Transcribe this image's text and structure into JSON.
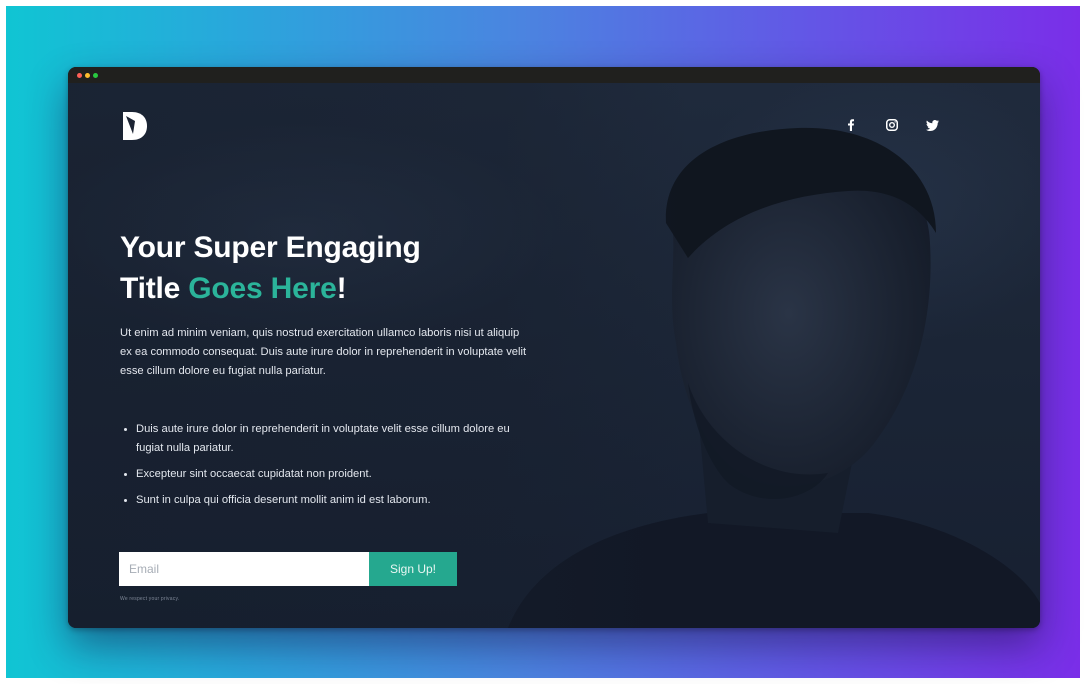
{
  "window": {
    "controls": [
      "close",
      "minimize",
      "maximize"
    ]
  },
  "header": {
    "logo_icon": "logo-d-icon",
    "social": [
      {
        "name": "facebook",
        "icon": "facebook-icon"
      },
      {
        "name": "instagram",
        "icon": "instagram-icon"
      },
      {
        "name": "twitter",
        "icon": "twitter-icon"
      }
    ]
  },
  "hero": {
    "title_line1": "Your Super Engaging",
    "title_word": "Title",
    "title_accent": "Goes Here",
    "title_end": "!",
    "intro": "Ut enim ad minim veniam, quis nostrud exercitation ullamco laboris nisi ut aliquip ex ea commodo consequat. Duis aute irure dolor in reprehenderit in voluptate velit esse cillum dolore eu fugiat nulla pariatur.",
    "bullets": [
      "Duis aute irure dolor in reprehenderit in voluptate velit esse cillum dolore eu fugiat nulla pariatur.",
      "Excepteur sint occaecat cupidatat non proident.",
      "Sunt in culpa qui officia deserunt mollit anim id est laborum."
    ]
  },
  "signup": {
    "email_placeholder": "Email",
    "email_value": "",
    "button_label": "Sign Up!",
    "privacy_note": "We respect your privacy."
  },
  "colors": {
    "accent": "#2bb49a",
    "button": "#25a88f",
    "background_gradient_start": "#10c5d3",
    "background_gradient_end": "#7a2ee8",
    "hero_background": "#1c2433"
  }
}
